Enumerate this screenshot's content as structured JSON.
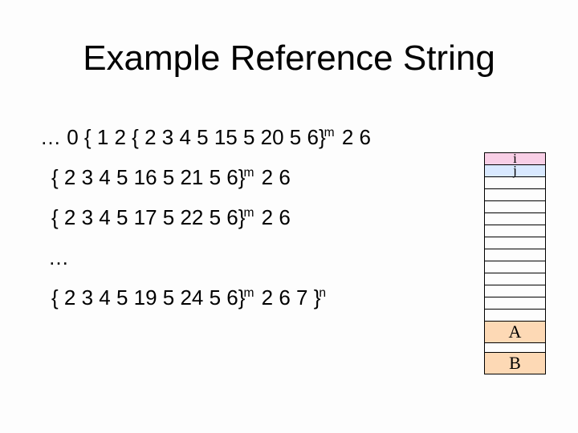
{
  "title": "Example Reference String",
  "lines": {
    "l1": {
      "pre": "… 0 { 1  2  { 2  3  4  5  15  5  20  5  6}",
      "sup": "m",
      "post": " 2  6"
    },
    "l2": {
      "pre": "{ 2  3  4  5  16  5  21  5  6}",
      "sup": "m",
      "post": " 2  6"
    },
    "l3": {
      "pre": "{ 2  3  4  5  17  5  22  5  6}",
      "sup": "m",
      "post": " 2  6"
    },
    "ellipsis": "…",
    "l4": {
      "pre": "{ 2  3  4  5  19  5  24  5  6}",
      "sup": "m",
      "mid": " 2  6  7 }",
      "sup2": "n",
      "post": ""
    }
  },
  "stack": {
    "i": "i",
    "j": "j",
    "A": "A",
    "B": "B"
  }
}
